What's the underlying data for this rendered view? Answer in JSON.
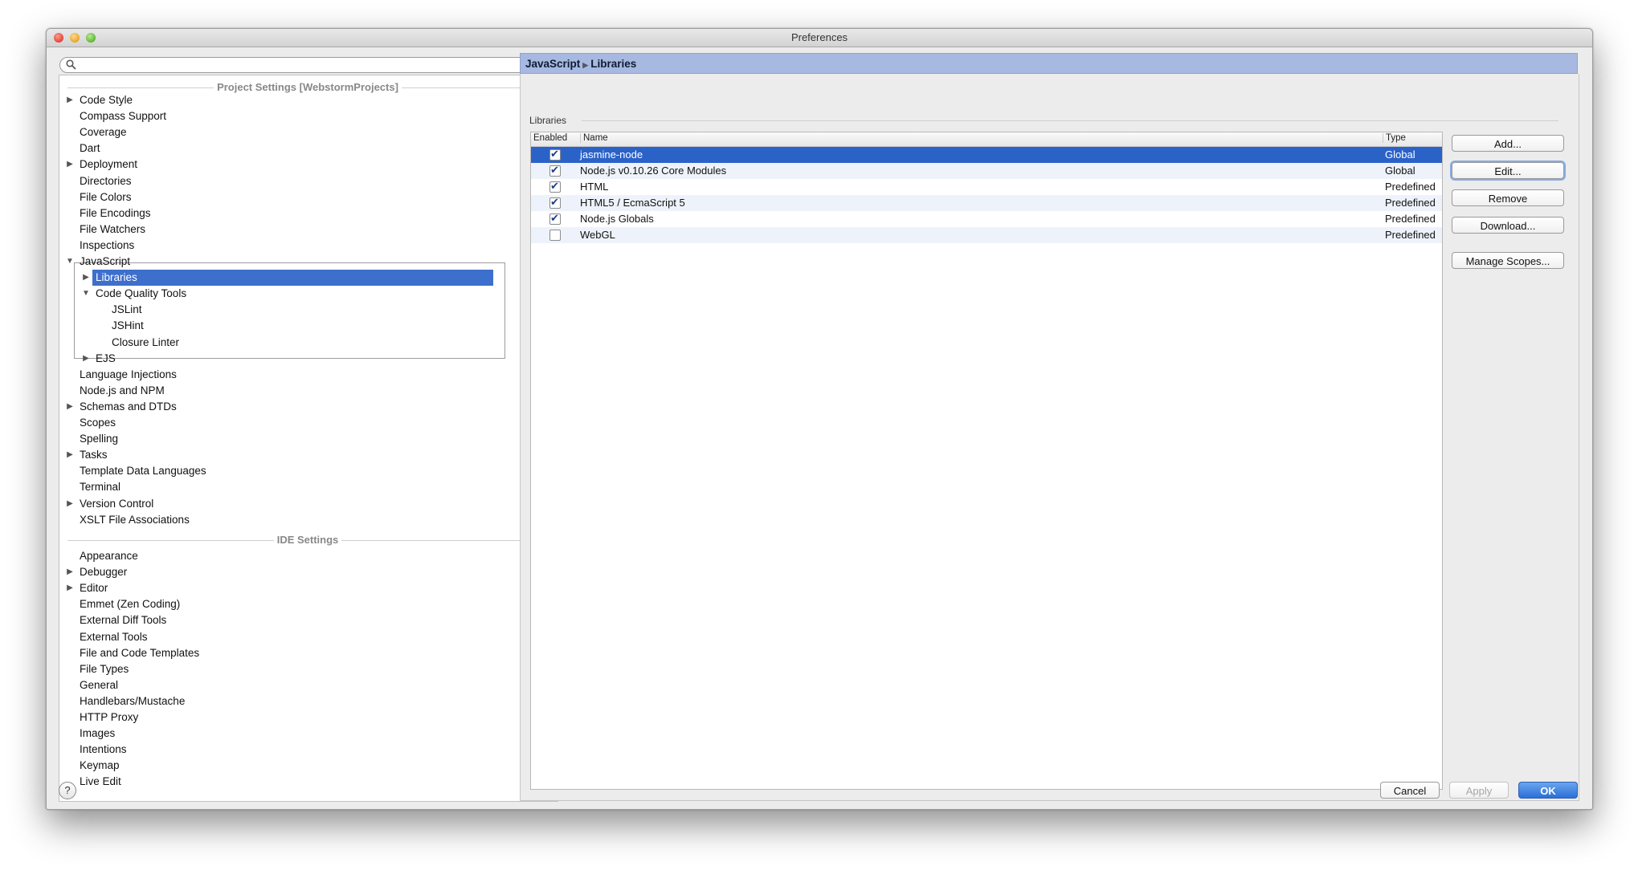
{
  "window": {
    "title": "Preferences"
  },
  "search": {
    "placeholder": ""
  },
  "tree": {
    "project_header": "Project Settings [WebstormProjects]",
    "ide_header": "IDE Settings",
    "project_items": [
      {
        "label": "Code Style",
        "arrow": "▶"
      },
      {
        "label": "Compass Support",
        "arrow": ""
      },
      {
        "label": "Coverage",
        "arrow": ""
      },
      {
        "label": "Dart",
        "arrow": ""
      },
      {
        "label": "Deployment",
        "arrow": "▶"
      },
      {
        "label": "Directories",
        "arrow": ""
      },
      {
        "label": "File Colors",
        "arrow": ""
      },
      {
        "label": "File Encodings",
        "arrow": ""
      },
      {
        "label": "File Watchers",
        "arrow": ""
      },
      {
        "label": "Inspections",
        "arrow": ""
      },
      {
        "label": "JavaScript",
        "arrow": "▼"
      }
    ],
    "js_children": [
      {
        "label": "Libraries",
        "arrow": "▶"
      },
      {
        "label": "Code Quality Tools",
        "arrow": "▼"
      },
      {
        "label": "JSLint",
        "arrow": ""
      },
      {
        "label": "JSHint",
        "arrow": ""
      },
      {
        "label": "Closure Linter",
        "arrow": ""
      },
      {
        "label": "EJS",
        "arrow": "▶"
      }
    ],
    "project_items_after": [
      {
        "label": "Language Injections",
        "arrow": ""
      },
      {
        "label": "Node.js and NPM",
        "arrow": ""
      },
      {
        "label": "Schemas and DTDs",
        "arrow": "▶"
      },
      {
        "label": "Scopes",
        "arrow": ""
      },
      {
        "label": "Spelling",
        "arrow": ""
      },
      {
        "label": "Tasks",
        "arrow": "▶"
      },
      {
        "label": "Template Data Languages",
        "arrow": ""
      },
      {
        "label": "Terminal",
        "arrow": ""
      },
      {
        "label": "Version Control",
        "arrow": "▶"
      },
      {
        "label": "XSLT File Associations",
        "arrow": ""
      }
    ],
    "ide_items": [
      {
        "label": "Appearance",
        "arrow": ""
      },
      {
        "label": "Debugger",
        "arrow": "▶"
      },
      {
        "label": "Editor",
        "arrow": "▶"
      },
      {
        "label": "Emmet (Zen Coding)",
        "arrow": ""
      },
      {
        "label": "External Diff Tools",
        "arrow": ""
      },
      {
        "label": "External Tools",
        "arrow": ""
      },
      {
        "label": "File and Code Templates",
        "arrow": ""
      },
      {
        "label": "File Types",
        "arrow": ""
      },
      {
        "label": "General",
        "arrow": ""
      },
      {
        "label": "Handlebars/Mustache",
        "arrow": ""
      },
      {
        "label": "HTTP Proxy",
        "arrow": ""
      },
      {
        "label": "Images",
        "arrow": ""
      },
      {
        "label": "Intentions",
        "arrow": ""
      },
      {
        "label": "Keymap",
        "arrow": ""
      },
      {
        "label": "Live Edit",
        "arrow": ""
      }
    ]
  },
  "breadcrumb": {
    "parent": "JavaScript",
    "current": "Libraries"
  },
  "libraries": {
    "group_title": "Libraries",
    "columns": {
      "enabled": "Enabled",
      "name": "Name",
      "type": "Type"
    },
    "rows": [
      {
        "enabled": true,
        "name": "jasmine-node",
        "type": "Global"
      },
      {
        "enabled": true,
        "name": "Node.js v0.10.26 Core Modules",
        "type": "Global"
      },
      {
        "enabled": true,
        "name": "HTML",
        "type": "Predefined"
      },
      {
        "enabled": true,
        "name": "HTML5 / EcmaScript 5",
        "type": "Predefined"
      },
      {
        "enabled": true,
        "name": "Node.js Globals",
        "type": "Predefined"
      },
      {
        "enabled": false,
        "name": "WebGL",
        "type": "Predefined"
      }
    ]
  },
  "side_buttons": {
    "add": "Add...",
    "edit": "Edit...",
    "remove": "Remove",
    "download": "Download...",
    "manage_scopes": "Manage Scopes..."
  },
  "footer": {
    "help": "?",
    "cancel": "Cancel",
    "apply": "Apply",
    "ok": "OK"
  },
  "colors": {
    "selection": "#2b62c8",
    "tree_selection": "#3d6fcc",
    "header": "#a7b9e0"
  }
}
